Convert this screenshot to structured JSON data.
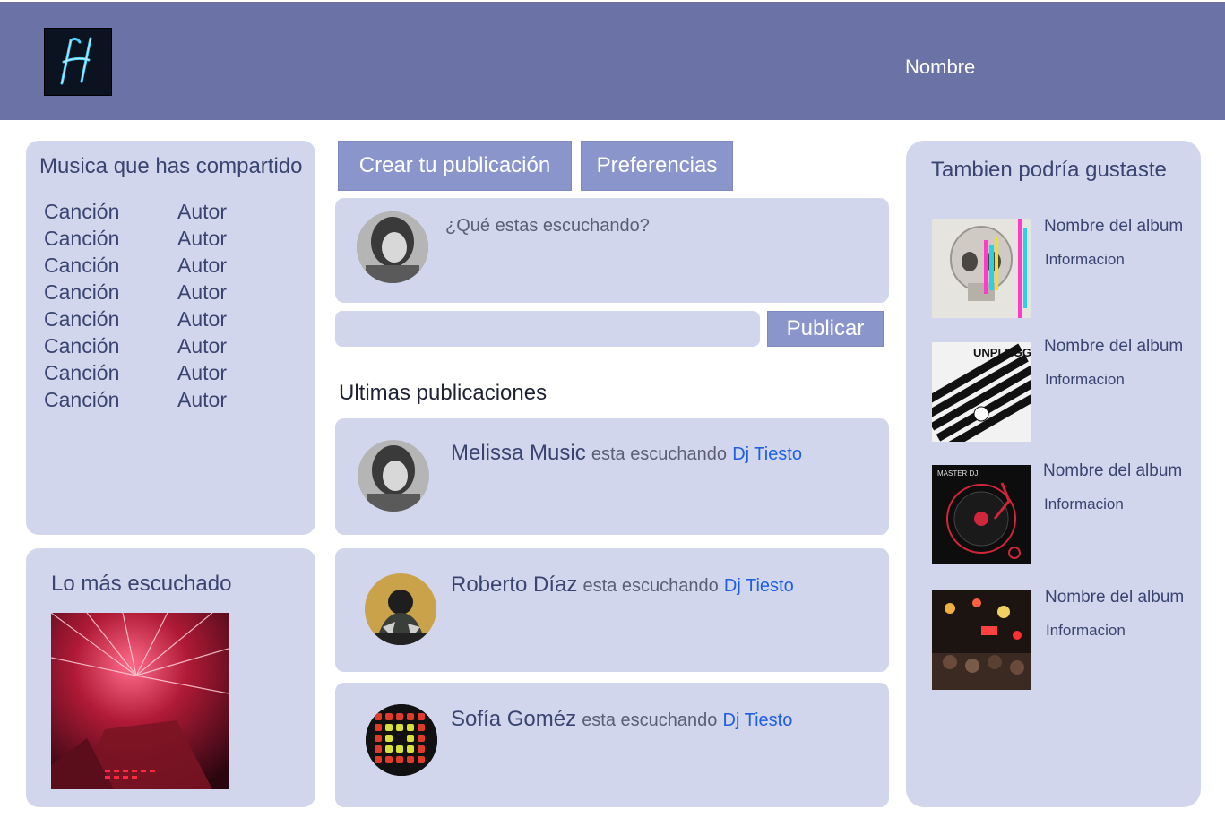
{
  "header": {
    "user_name": "Nombre"
  },
  "shared_music": {
    "title": "Musica que has compartido",
    "songs": [
      {
        "song": "Canción",
        "author": "Autor"
      },
      {
        "song": "Canción",
        "author": "Autor"
      },
      {
        "song": "Canción",
        "author": "Autor"
      },
      {
        "song": "Canción",
        "author": "Autor"
      },
      {
        "song": "Canción",
        "author": "Autor"
      },
      {
        "song": "Canción",
        "author": "Autor"
      },
      {
        "song": "Canción",
        "author": "Autor"
      },
      {
        "song": "Canción",
        "author": "Autor"
      }
    ]
  },
  "most_listened": {
    "title": "Lo más escuchado"
  },
  "actions": {
    "create_post": "Crear tu publicación",
    "preferences": "Preferencias"
  },
  "composer": {
    "prompt": "¿Qué estas escuchando?",
    "publish": "Publicar"
  },
  "feed": {
    "title": "Ultimas publicaciones",
    "posts": [
      {
        "user": "Melissa Music",
        "verb": "esta escuchando",
        "artist": "Dj Tiesto"
      },
      {
        "user": "Roberto Díaz",
        "verb": "esta escuchando",
        "artist": "Dj Tiesto"
      },
      {
        "user": "Sofía Goméz",
        "verb": "esta escuchando",
        "artist": "Dj Tiesto"
      }
    ]
  },
  "recommendations": {
    "title": "Tambien podría gustaste",
    "albums": [
      {
        "name": "Nombre del album",
        "info": "Informacion",
        "cover_label": ""
      },
      {
        "name": "Nombre del album",
        "info": "Informacion",
        "cover_label": "UNPLUGGED"
      },
      {
        "name": "Nombre del album",
        "info": "Informacion",
        "cover_label": "MASTER DJ"
      },
      {
        "name": "Nombre del album",
        "info": "Informacion",
        "cover_label": ""
      }
    ]
  },
  "colors": {
    "header": "#6b72a6",
    "panel": "#d1d6ec",
    "button": "#8a95cc",
    "text": "#3a4470",
    "link": "#1f5fe0"
  }
}
